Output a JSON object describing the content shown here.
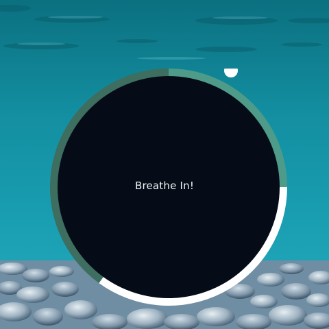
{
  "prompt": {
    "text": "Breathe In!"
  },
  "breath_cycle": {
    "segments": [
      {
        "phase": "inhale",
        "color": "#4e9b8a",
        "fraction": 0.25
      },
      {
        "phase": "hold",
        "color": "#ffffff",
        "fraction": 0.35
      },
      {
        "phase": "exhale",
        "color": "#3d6e5f",
        "fraction": 0.4
      }
    ],
    "indicator_color": "#ffffff"
  },
  "colors": {
    "water_top": "#0f7f8f",
    "water_mid": "#1a9db0",
    "disc": "#050c17"
  },
  "icons": {
    "indicator": "progress-dot-icon",
    "background": "underwater-pebbles-photo"
  }
}
